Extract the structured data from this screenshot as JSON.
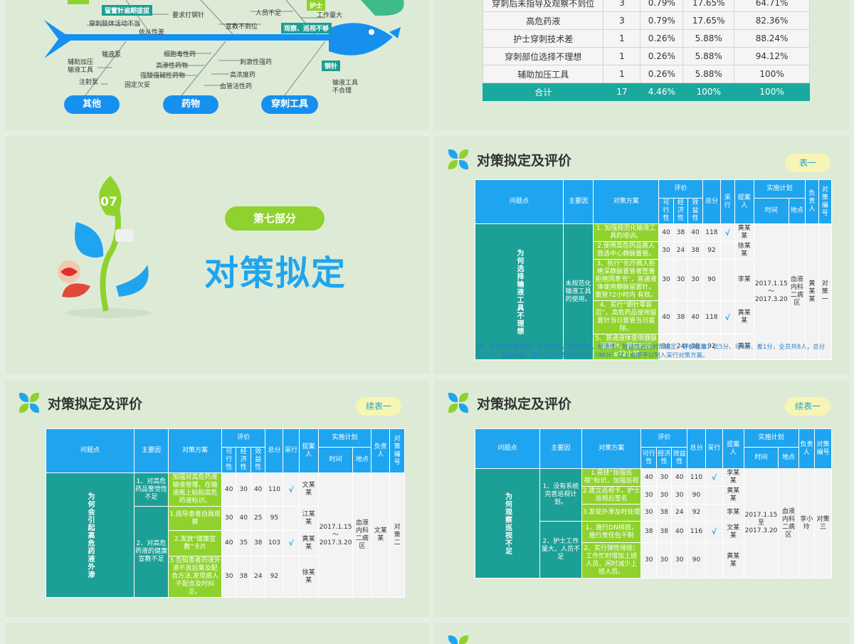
{
  "fishbone": {
    "tags": [
      "留置针逾期拔拔",
      "护士",
      "观察、巡视不够",
      "钢针"
    ],
    "labels": [
      "要求打钢针",
      "穿刺肢体活动不当",
      "依从性差",
      "人员不足",
      "工作量大",
      "宣教不到位",
      "辅助加压",
      "输液工具",
      "输液泵",
      "注射泵",
      "固定欠妥",
      "细胞毒性药",
      "高渗性药物",
      "强酸强碱性药物",
      "刺激性强药",
      "高浓度药",
      "血管活性药",
      "输液工具",
      "不合理"
    ],
    "categories": [
      "其他",
      "药物",
      "穿刺工具"
    ]
  },
  "pareto": {
    "rows": [
      [
        "穿刺后未指导及观察不到位",
        "3",
        "0.79%",
        "17.65%",
        "64.71%"
      ],
      [
        "高危药液",
        "3",
        "0.79%",
        "17.65%",
        "82.36%"
      ],
      [
        "护士穿刺技术差",
        "1",
        "0.26%",
        "5.88%",
        "88.24%"
      ],
      [
        "穿刺部位选择不理想",
        "1",
        "0.26%",
        "5.88%",
        "94.12%"
      ],
      [
        "辅助加压工具",
        "1",
        "0.26%",
        "5.88%",
        "100%"
      ]
    ],
    "total": [
      "合计",
      "17",
      "4.46%",
      "100%",
      "100%"
    ]
  },
  "section": {
    "number": "07",
    "part": "第七部分",
    "title": "对策拟定"
  },
  "common": {
    "heading": "对策拟定及评价",
    "h_issue": "问题点",
    "h_cause": "主要因",
    "h_plan": "对策方案",
    "h_eval": "评价",
    "h_feas": "可行性",
    "h_econ": "经济性",
    "h_eff": "效益性",
    "h_total": "总分",
    "h_adopt": "采行",
    "h_proposer": "提案人",
    "h_schedule": "实施计划",
    "h_time": "时间",
    "h_place": "地点",
    "h_owner": "负责人",
    "h_no": "对策编号"
  },
  "table1": {
    "badge": "表一",
    "issue": "为何选择输液工具不理想",
    "cause": "未规范化输液工具的使用。",
    "rows": [
      {
        "plan": "1. 加强规范化输液工具的培训。",
        "f": "40",
        "e": "38",
        "b": "40",
        "t": "118",
        "a": "√",
        "p": "黄某某"
      },
      {
        "plan": "2.使用高危药品病人首选中心静脉置管。",
        "f": "30",
        "e": "24",
        "b": "38",
        "t": "92",
        "a": "",
        "p": "徐某某"
      },
      {
        "plan": "3、执行“化疗病人拒绝深静脉置管者签署拒绝同意书”，普通液体使用静脉留置针，置管72小时内 有效。",
        "f": "30",
        "e": "30",
        "b": "30",
        "t": "90",
        "a": "",
        "p": "李某"
      },
      {
        "plan": "4、实行“钢针零容忍”，高危药品使用留置针当日置管当日拔除。",
        "f": "40",
        "e": "38",
        "b": "40",
        "t": "118",
        "a": "√",
        "p": "黄某某"
      },
      {
        "plan": "5、普通液体使用静脉留置针，置管时间≤72小时",
        "f": "30",
        "e": "24",
        "b": "38",
        "t": "92",
        "a": "",
        "p": "黄某"
      }
    ],
    "time": "2017.1.15～2017.3.20",
    "place": "血液内科二病区",
    "owner": "黄某某",
    "no": "对策一",
    "note_prefix": "注：",
    "note1": "全体全员根据每一评价项目，依可行性、经济性、效益性进行对策选定。",
    "note_std": "评价标准：",
    "note2": "优5分、可3分、差1分，全员共8人，总分120分。",
    "note_basis": "选定依据：",
    "note3": "满分120分得分达80%（96分）以上者即予以列入采行对策方案。"
  },
  "table2": {
    "badge": "续表一",
    "issue": "为何会引起高危药液外渗",
    "causes": [
      "1、对高危药品警觉性不足",
      "2、对高危药液的健康宣教不足"
    ],
    "rows": [
      {
        "plan": "加强对高危药液输液管理，在输液瓶上粘贴高危药液标识。",
        "f": "40",
        "e": "30",
        "b": "40",
        "t": "110",
        "a": "√",
        "p": "文某某"
      },
      {
        "plan": "1.指导患者自我观察",
        "f": "30",
        "e": "40",
        "b": "25",
        "t": "95",
        "a": "",
        "p": "江某某"
      },
      {
        "plan": "2.发放“健康宣教”卡片",
        "f": "40",
        "e": "35",
        "b": "38",
        "t": "103",
        "a": "√",
        "p": "黄某某"
      },
      {
        "plan": "3.告知患者药液外渗不良后果及配合方法,发现病人不配合及时纠正。",
        "f": "30",
        "e": "38",
        "b": "24",
        "t": "92",
        "a": "",
        "p": "徐某某"
      }
    ],
    "time": "2017.1.15～2017.3.20",
    "place": "血液内科二病区",
    "owner": "文某某",
    "no": "对策二"
  },
  "table3": {
    "badge": "续表一",
    "issue": "为何观察巡视不足",
    "causes": [
      "1、没有系统完善巡视计划。",
      "2、护士工作量大，人员不足"
    ],
    "rows": [
      {
        "plan": "1.悬挂“加强巡视”标识，加强巡视",
        "f": "40",
        "e": "30",
        "b": "40",
        "t": "110",
        "a": "√",
        "p": "李某某"
      },
      {
        "plan": "2.建立巡视卡，护士巡视后签名",
        "f": "30",
        "e": "30",
        "b": "30",
        "t": "90",
        "a": "",
        "p": "黄某某"
      },
      {
        "plan": "3.发现外渗及时处理",
        "f": "30",
        "e": "38",
        "b": "24",
        "t": "92",
        "a": "",
        "p": "李某"
      },
      {
        "plan": "1、施行DN排班，施行责任包干制",
        "f": "38",
        "e": "38",
        "b": "40",
        "t": "116",
        "a": "√",
        "p": "文某某"
      },
      {
        "plan": "2、实行弹性排班：工作忙时增加上班人员，闲时减少上班人员。",
        "f": "30",
        "e": "30",
        "b": "30",
        "t": "90",
        "a": "",
        "p": "黄某某"
      }
    ],
    "time": "2017.1.15至2017.3.20",
    "place": "血液内科二病区",
    "owner": "李小玲",
    "no": "对策三"
  },
  "colors": {
    "blue": "#1fa5ef",
    "teal": "#1c9f96",
    "green": "#8fd22e",
    "bg": "#ddebd6"
  }
}
